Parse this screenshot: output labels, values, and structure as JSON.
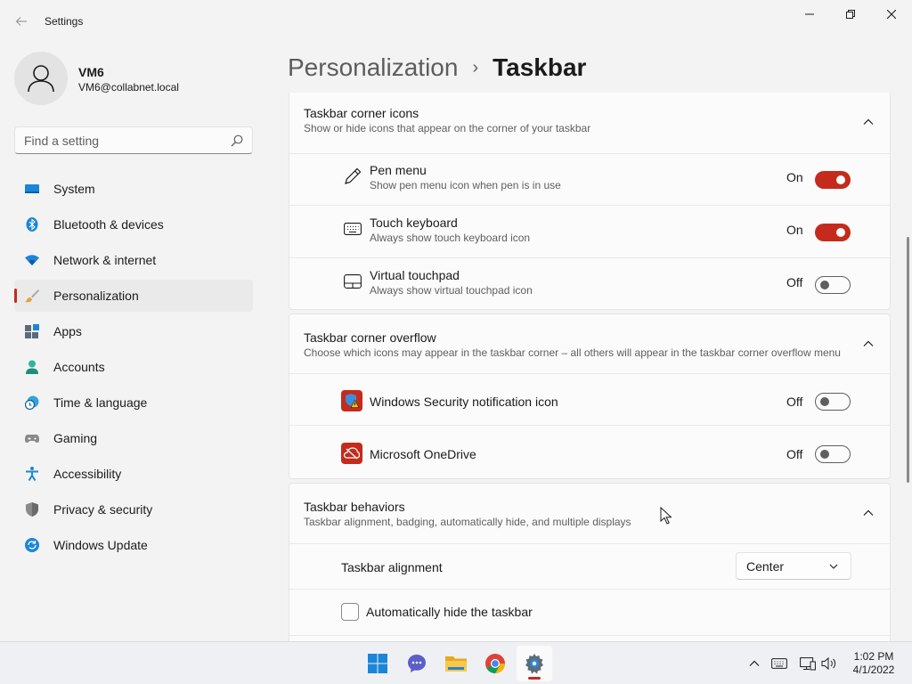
{
  "window": {
    "app_title": "Settings"
  },
  "user": {
    "name": "VM6",
    "email": "VM6@collabnet.local"
  },
  "search": {
    "placeholder": "Find a setting"
  },
  "nav": {
    "items": [
      {
        "label": "System",
        "icon": "monitor-icon"
      },
      {
        "label": "Bluetooth & devices",
        "icon": "bluetooth-icon"
      },
      {
        "label": "Network & internet",
        "icon": "wifi-icon"
      },
      {
        "label": "Personalization",
        "icon": "paintbrush-icon",
        "active": true
      },
      {
        "label": "Apps",
        "icon": "apps-icon"
      },
      {
        "label": "Accounts",
        "icon": "person-icon"
      },
      {
        "label": "Time & language",
        "icon": "clock-globe-icon"
      },
      {
        "label": "Gaming",
        "icon": "gamepad-icon"
      },
      {
        "label": "Accessibility",
        "icon": "accessibility-icon"
      },
      {
        "label": "Privacy & security",
        "icon": "shield-icon"
      },
      {
        "label": "Windows Update",
        "icon": "update-icon"
      }
    ]
  },
  "breadcrumb": {
    "parent": "Personalization",
    "separator": "›",
    "current": "Taskbar"
  },
  "sections": {
    "corner_icons": {
      "title": "Taskbar corner icons",
      "description": "Show or hide icons that appear on the corner of your taskbar",
      "items": [
        {
          "title": "Pen menu",
          "description": "Show pen menu icon when pen is in use",
          "state": "On",
          "on": true,
          "icon": "pen-icon"
        },
        {
          "title": "Touch keyboard",
          "description": "Always show touch keyboard icon",
          "state": "On",
          "on": true,
          "icon": "keyboard-icon"
        },
        {
          "title": "Virtual touchpad",
          "description": "Always show virtual touchpad icon",
          "state": "Off",
          "on": false,
          "icon": "touchpad-icon"
        }
      ]
    },
    "corner_overflow": {
      "title": "Taskbar corner overflow",
      "description": "Choose which icons may appear in the taskbar corner – all others will appear in the taskbar corner overflow menu",
      "items": [
        {
          "title": "Windows Security notification icon",
          "state": "Off",
          "on": false,
          "icon": "windows-security-icon"
        },
        {
          "title": "Microsoft OneDrive",
          "state": "Off",
          "on": false,
          "icon": "onedrive-icon"
        }
      ]
    },
    "behaviors": {
      "title": "Taskbar behaviors",
      "description": "Taskbar alignment, badging, automatically hide, and multiple displays",
      "alignment": {
        "label": "Taskbar alignment",
        "value": "Center"
      },
      "autohide": {
        "label": "Automatically hide the taskbar",
        "checked": false
      }
    }
  },
  "taskbar": {
    "apps": [
      "start-icon",
      "chat-icon",
      "file-explorer-icon",
      "chrome-icon",
      "settings-icon"
    ],
    "tray": [
      "chevron-up-icon",
      "keyboard-icon",
      "network-icon",
      "volume-icon"
    ],
    "time": "1:02 PM",
    "date": "4/1/2022"
  },
  "colors": {
    "accent": "#c42b1c",
    "background": "#f3f3f3",
    "card": "#fbfbfb"
  }
}
